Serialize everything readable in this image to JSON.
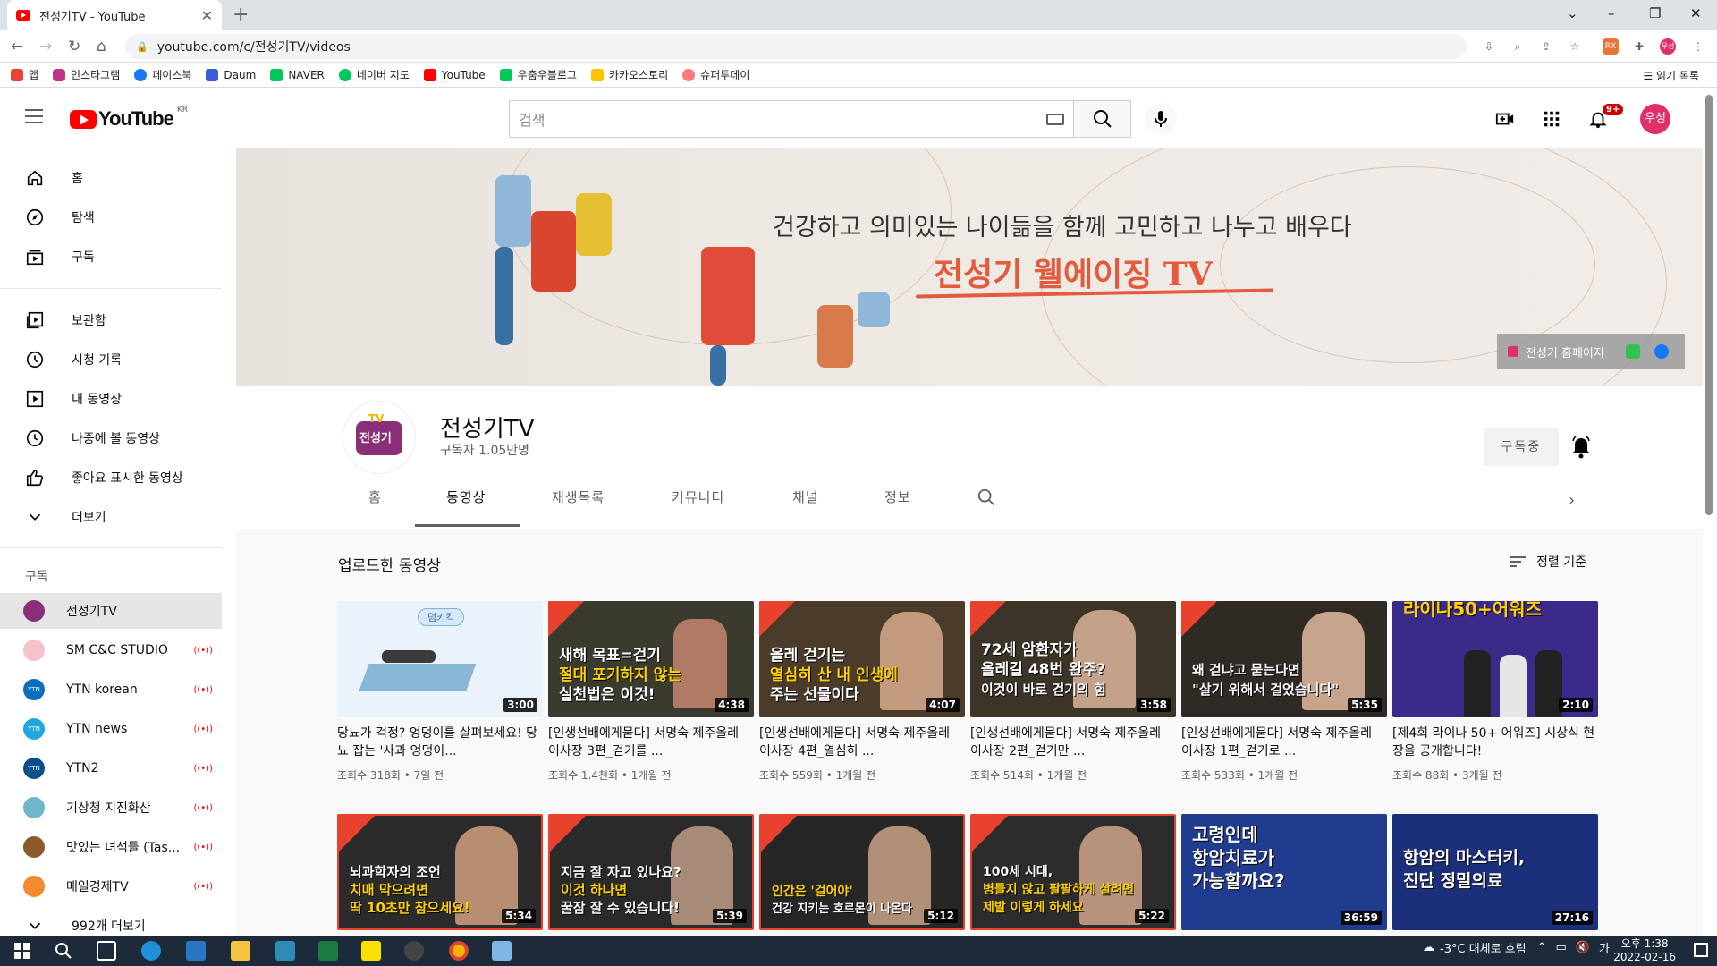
{
  "browser": {
    "tab_title": "전성기TV - YouTube",
    "url": "youtube.com/c/전성기TV/videos",
    "bookmarks": [
      {
        "label": "앱",
        "color": "#ea4335"
      },
      {
        "label": "인스타그램",
        "color": "#c13584"
      },
      {
        "label": "페이스북",
        "color": "#1877f2"
      },
      {
        "label": "Daum",
        "color": "#3b5bdb"
      },
      {
        "label": "NAVER",
        "color": "#03c75a"
      },
      {
        "label": "네이버 지도",
        "color": "#03c75a"
      },
      {
        "label": "YouTube",
        "color": "#ff0000"
      },
      {
        "label": "우춤우블로그",
        "color": "#03c75a"
      },
      {
        "label": "카카오스토리",
        "color": "#f7c600"
      },
      {
        "label": "슈퍼투데이",
        "color": "#ff7a7a"
      }
    ],
    "reading_list": "읽기 목록"
  },
  "header": {
    "logo_text": "YouTube",
    "region": "KR",
    "search_placeholder": "검색",
    "notification_count": "9+",
    "avatar_text": "우성"
  },
  "sidebar": {
    "main": [
      {
        "label": "홈",
        "icon": "home-icon"
      },
      {
        "label": "탐색",
        "icon": "compass-icon"
      },
      {
        "label": "구독",
        "icon": "subscriptions-icon"
      }
    ],
    "library": [
      {
        "label": "보관함",
        "icon": "library-icon"
      },
      {
        "label": "시청 기록",
        "icon": "history-icon"
      },
      {
        "label": "내 동영상",
        "icon": "my-videos-icon"
      },
      {
        "label": "나중에 볼 동영상",
        "icon": "watch-later-icon"
      },
      {
        "label": "좋아요 표시한 동영상",
        "icon": "thumbs-up-icon"
      },
      {
        "label": "더보기",
        "icon": "chevron-down-icon"
      }
    ],
    "subscriptions_title": "구독",
    "subscriptions": [
      {
        "label": "전성기TV",
        "color": "#8b2e7a",
        "live": false,
        "selected": true
      },
      {
        "label": "SM C&C STUDIO",
        "color": "#f4c2c8",
        "live": true,
        "selected": false
      },
      {
        "label": "YTN korean",
        "color": "#0a6ebd",
        "live": true,
        "selected": false
      },
      {
        "label": "YTN news",
        "color": "#1fa8e0",
        "live": true,
        "selected": false
      },
      {
        "label": "YTN2",
        "color": "#0b4f8a",
        "live": true,
        "selected": false
      },
      {
        "label": "기상청 지진화산",
        "color": "#6fb7c9",
        "live": true,
        "selected": false
      },
      {
        "label": "맛있는 녀석들 (Tas...",
        "color": "#8a5a2b",
        "live": true,
        "selected": false
      },
      {
        "label": "매일경제TV",
        "color": "#f28a30",
        "live": true,
        "selected": false
      }
    ],
    "more_subs": "992개 더보기"
  },
  "banner": {
    "line1": "건강하고 의미있는 나이듦을 함께 고민하고 나누고 배우다",
    "line2": "전성기 웰에이징 TV",
    "link_label": "전성기 홈페이지"
  },
  "channel": {
    "avatar_tv": "TV",
    "avatar_name": "전성기",
    "name": "전성기TV",
    "subscribers": "구독자 1.05만명",
    "subscribe_label": "구독중",
    "tabs": [
      "홈",
      "동영상",
      "재생목록",
      "커뮤니티",
      "채널",
      "정보"
    ],
    "selected_tab": "동영상"
  },
  "videos": {
    "section_title": "업로드한 동영상",
    "sort_label": "정렬 기준",
    "row1": [
      {
        "title": "당뇨가 걱정? 엉덩이를 살펴보세요! 당뇨 잡는 '사과 엉덩이...",
        "meta": "조회수 318회 • 7일 전",
        "duration": "3:00",
        "thumb_text": [
          "덤키킥"
        ],
        "bg": "#eaf3fb"
      },
      {
        "title": "[인생선배에게묻다] 서명숙 제주올레 이사장 3편_걷기를 ...",
        "meta": "조회수 1.4천회 • 1개월 전",
        "duration": "4:38",
        "thumb_text": [
          "새해 목표=걷기",
          "절대 포기하지 않는",
          "실천법은 이것!"
        ],
        "bg": "#3a3a2e"
      },
      {
        "title": "[인생선배에게묻다] 서명숙 제주올레 이사장 4편_열심히 ...",
        "meta": "조회수 559회 • 1개월 전",
        "duration": "4:07",
        "thumb_text": [
          "올레 걷기는",
          "열심히 산 내 인생에",
          "주는 선물이다"
        ],
        "bg": "#4a3b2a"
      },
      {
        "title": "[인생선배에게묻다] 서명숙 제주올레 이사장 2편_걷기만 ...",
        "meta": "조회수 514회 • 1개월 전",
        "duration": "3:58",
        "thumb_text": [
          "72세 암환자가",
          "올레길 48번 완주?",
          "이것이 바로 걷기의 힘"
        ],
        "bg": "#3d3428"
      },
      {
        "title": "[인생선배에게묻다] 서명숙 제주올레 이사장 1편_걷기로 ...",
        "meta": "조회수 533회 • 1개월 전",
        "duration": "5:35",
        "thumb_text": [
          "왜 걷냐고 묻는다면",
          "\"살기 위해서 걸었습니다\""
        ],
        "bg": "#2f2a24"
      },
      {
        "title": "[제4회 라이나 50+ 어워즈] 시상식 현장을 공개합니다!",
        "meta": "조회수 88회 • 3개월 전",
        "duration": "2:10",
        "thumb_text": [
          "라이나50+어워즈"
        ],
        "bg": "#3b2a8a"
      }
    ],
    "row2": [
      {
        "duration": "5:34",
        "thumb_text": [
          "뇌과학자의 조언",
          "치매 막으려면",
          "딱 10초만 참으세요!"
        ],
        "bg": "#2b2b2b"
      },
      {
        "duration": "5:39",
        "thumb_text": [
          "지금 잘 자고 있나요?",
          "이것 하나면",
          "꿀잠 잘 수 있습니다!"
        ],
        "bg": "#2a2a2a"
      },
      {
        "duration": "5:12",
        "thumb_text": [
          "인간은 '걸어야'",
          "건강 지키는 호르몬이 나온다"
        ],
        "bg": "#262626"
      },
      {
        "duration": "5:22",
        "thumb_text": [
          "100세 시대,",
          "병들지 않고 팔팔하게 살려면",
          "제발 이렇게 하세요"
        ],
        "bg": "#2c2c2c"
      },
      {
        "duration": "36:59",
        "thumb_text": [
          "고령인데",
          "항암치료가",
          "가능할까요?"
        ],
        "bg": "#1f3c8f"
      },
      {
        "duration": "27:16",
        "thumb_text": [
          "항암의 마스터키,",
          "진단 정밀의료"
        ],
        "bg": "#1c2f7a"
      }
    ]
  },
  "taskbar": {
    "weather": "-3°C 대체로 흐림",
    "time": "오후 1:38",
    "date": "2022-02-16"
  }
}
